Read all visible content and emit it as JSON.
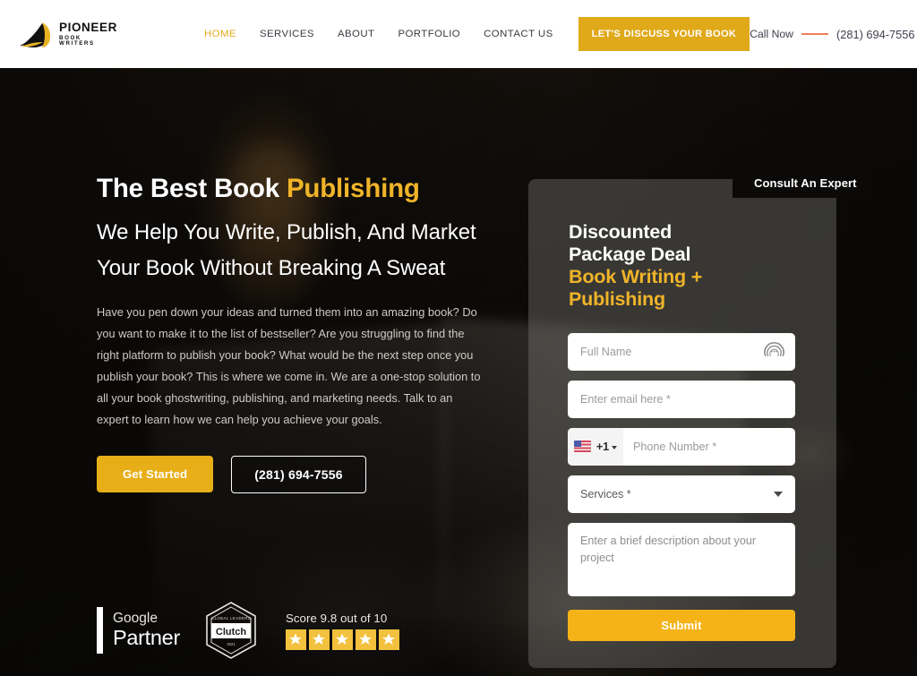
{
  "header": {
    "logo": {
      "name": "PIONEER",
      "sub": "BOOK WRITERS",
      "icon": "quill-pen-logo"
    },
    "nav": [
      {
        "label": "HOME",
        "active": true
      },
      {
        "label": "SERVICES",
        "active": false
      },
      {
        "label": "ABOUT",
        "active": false
      },
      {
        "label": "PORTFOLIO",
        "active": false
      },
      {
        "label": "CONTACT US",
        "active": false
      }
    ],
    "cta_label": "LET'S DISCUSS YOUR BOOK",
    "call_now_label": "Call Now",
    "call_now_number": "(281) 694-7556",
    "accent_color": "#e0a91a",
    "rule_color": "#f0805c"
  },
  "hero": {
    "title_plain": "The Best Book ",
    "title_accent": "Publishing",
    "subtitle": "We Help You Write, Publish, And Market Your Book Without Breaking A Sweat",
    "paragraph": "Have you pen down your ideas and turned them into an amazing book? Do you want to make it to the list of bestseller? Are you struggling to find the right platform to publish your book? What would be the next step once you publish your book? This is where we come in. We are a one-stop solution to all your book ghostwriting, publishing, and marketing needs. Talk to an expert to learn how we can help you achieve your goals.",
    "primary_button": "Get Started",
    "phone_button": "(281) 694-7556"
  },
  "badges": {
    "google_partner": {
      "line1": "Google",
      "line2": "Partner"
    },
    "clutch": {
      "top": "GLOBAL LEADERS",
      "name": "Clutch",
      "year": "2021"
    },
    "rating": {
      "score_text": "Score 9.8 out of 10",
      "stars": 5,
      "star_color": "#f2c13d"
    }
  },
  "form_panel": {
    "tab_label": "Consult An Expert",
    "heading_white_1": "Discounted",
    "heading_white_2": "Package Deal",
    "heading_yellow_1": "Book Writing +",
    "heading_yellow_2": "Publishing",
    "fields": {
      "full_name": {
        "placeholder": "Full Name",
        "value": "",
        "icon": "voice-chat-icon"
      },
      "email": {
        "placeholder": "Enter email here *",
        "value": ""
      },
      "phone": {
        "placeholder": "Phone Number *",
        "value": "",
        "country_code": "+1",
        "flag": "us-flag-icon"
      },
      "services": {
        "label": "Services *",
        "icon": "chevron-down-icon"
      },
      "description": {
        "placeholder": "Enter a brief description about your project",
        "value": ""
      }
    },
    "submit_label": "Submit",
    "submit_color": "#f5b318"
  }
}
